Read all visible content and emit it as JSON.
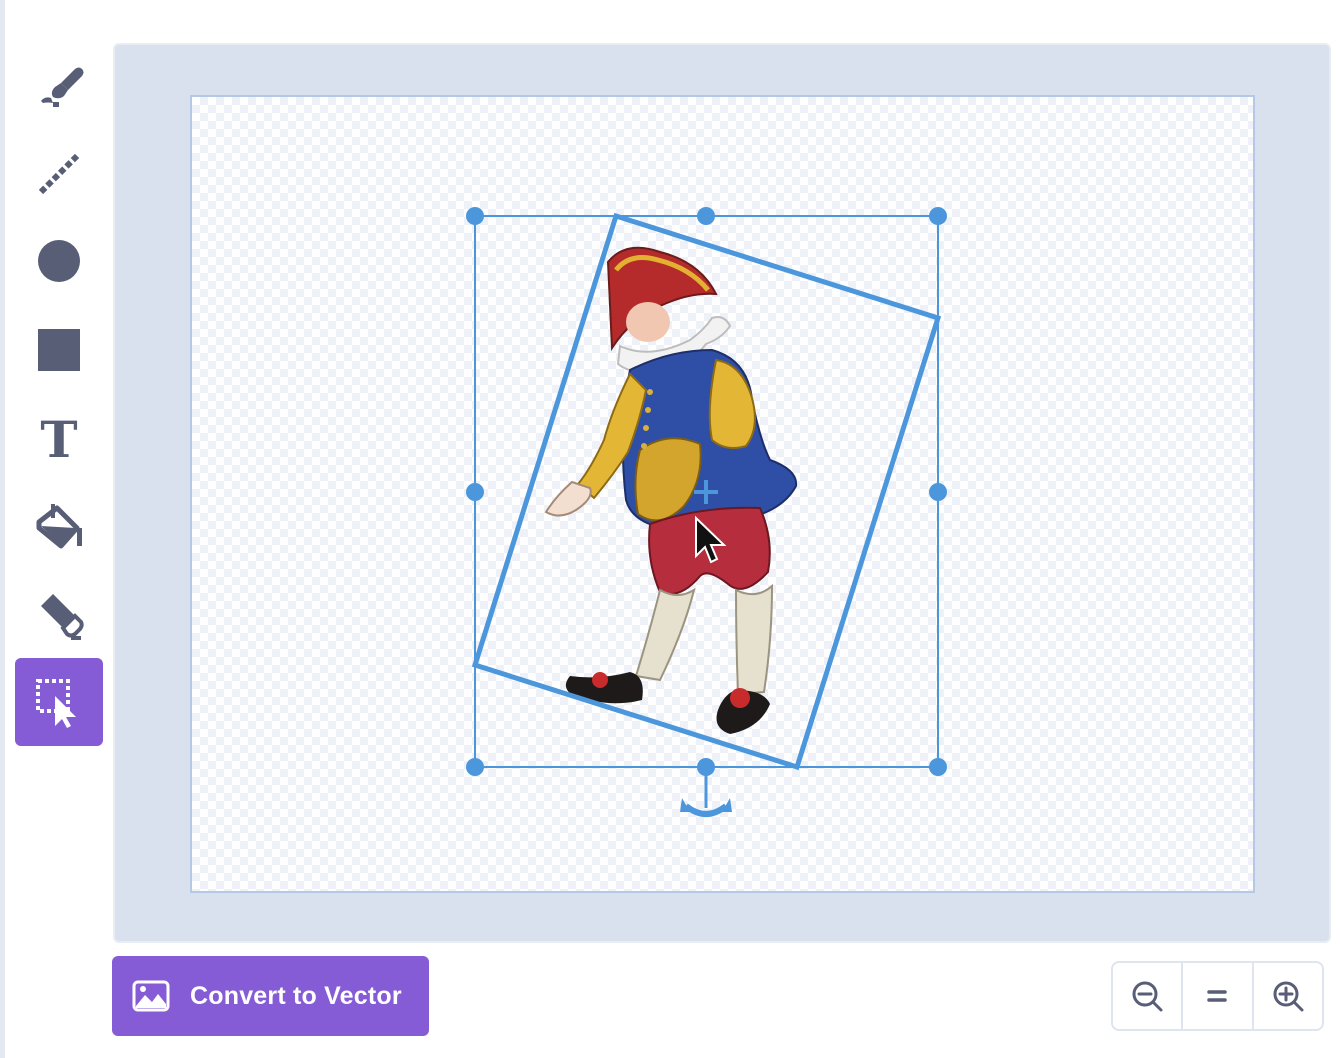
{
  "toolbar": {
    "tools": [
      {
        "icon": "brush-icon",
        "label": "Brush"
      },
      {
        "icon": "line-icon",
        "label": "Line"
      },
      {
        "icon": "circle-icon",
        "label": "Circle"
      },
      {
        "icon": "rectangle-icon",
        "label": "Rectangle"
      },
      {
        "icon": "text-icon",
        "label": "Text"
      },
      {
        "icon": "fill-icon",
        "label": "Fill"
      },
      {
        "icon": "eraser-icon",
        "label": "Eraser"
      },
      {
        "icon": "select-icon",
        "label": "Select",
        "active": true
      }
    ],
    "text_tool_glyph": "T"
  },
  "canvas": {
    "selected_item": "jester-bitmap-image",
    "selection_handles": 8,
    "rotation_handle": "rotate-icon"
  },
  "footer": {
    "convert_button": {
      "label": "Convert to Vector",
      "icon": "image-icon"
    },
    "zoom": {
      "zoom_out_icon": "zoom-out-icon",
      "reset_label": "=",
      "zoom_in_icon": "zoom-in-icon"
    }
  },
  "colors": {
    "accent": "#855cd6",
    "selection": "#4c97dc",
    "tool_icon": "#575e75",
    "stage_bg": "#d9e1ef"
  }
}
